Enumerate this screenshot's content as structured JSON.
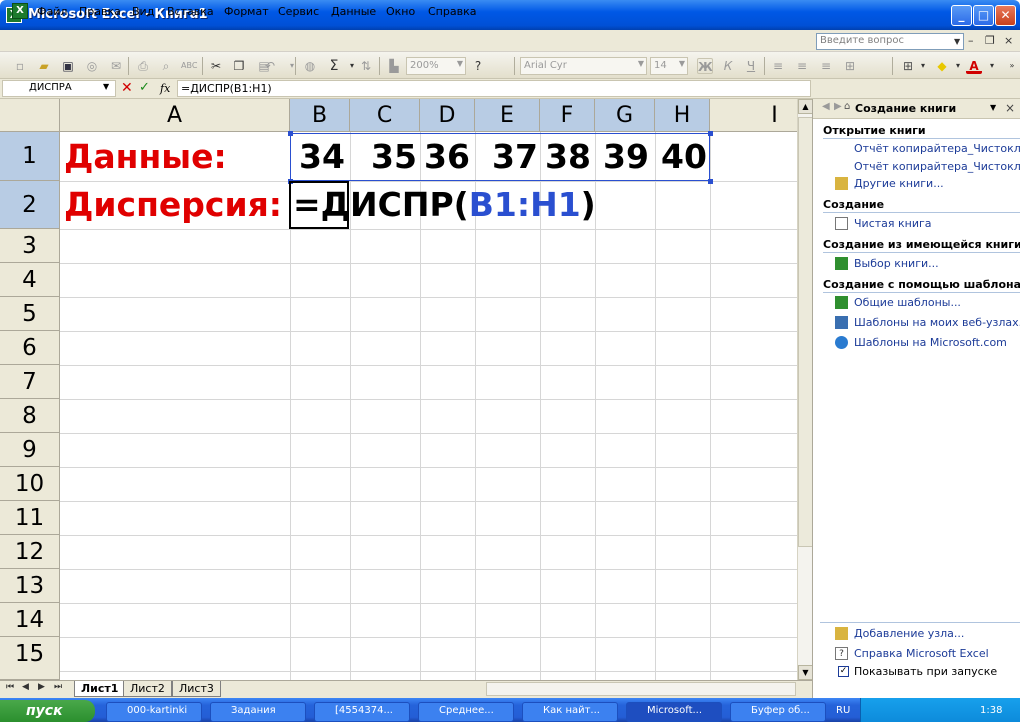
{
  "window": {
    "title": "Microsoft Excel - Книга1",
    "app_icon": "excel-icon"
  },
  "menu": {
    "items": [
      "Файл",
      "Правка",
      "Вид",
      "Вставка",
      "Формат",
      "Сервис",
      "Данные",
      "Окно",
      "Справка"
    ],
    "ask_placeholder": "Введите вопрос"
  },
  "toolbar": {
    "zoom": "200%",
    "font_name": "Arial Cyr",
    "font_size": "14",
    "bold": "Ж",
    "italic": "К",
    "underline": "Ч"
  },
  "formula_bar": {
    "name_box": "ДИСПРА",
    "fx": "fx",
    "formula": "=ДИСПР(B1:H1)"
  },
  "columns": [
    "A",
    "B",
    "C",
    "D",
    "E",
    "F",
    "G",
    "H",
    "I"
  ],
  "rows": [
    "1",
    "2",
    "3",
    "4",
    "5",
    "6",
    "7",
    "8",
    "9",
    "10",
    "11",
    "12",
    "13",
    "14",
    "15"
  ],
  "cells": {
    "a1": "Данные:",
    "a2": "Дисперсия:",
    "b1": "34",
    "c1": "35",
    "d1": "36",
    "e1": "37",
    "f1": "38",
    "g1": "39",
    "h1": "40",
    "b2_prefix": "=ДИСПР(",
    "b2_ref": "B1:H1",
    "b2_suffix": ")"
  },
  "sheets": [
    "Лист1",
    "Лист2",
    "Лист3"
  ],
  "task_pane": {
    "title": "Создание книги",
    "open_section": "Открытие книги",
    "recent_1": "Отчёт копирайтера_Чистоклето",
    "recent_2": "Отчёт копирайтера_Чистоклето",
    "more_books": "Другие книги...",
    "create_section": "Создание",
    "blank_book": "Чистая книга",
    "existing_section": "Создание из имеющейся книги",
    "choose_book": "Выбор книги...",
    "template_section": "Создание с помощью шаблона",
    "general_templates": "Общие шаблоны...",
    "web_templates": "Шаблоны на моих веб-узлах...",
    "ms_templates": "Шаблоны на Microsoft.com",
    "add_node": "Добавление узла...",
    "excel_help": "Справка Microsoft Excel",
    "show_startup": "Показывать при запуске"
  },
  "taskbar": {
    "start": "пуск",
    "tasks": [
      "000-kartinki",
      "Задания",
      "[4554374...",
      "Среднее...",
      "Как найт...",
      "Microsoft...",
      "Буфер об..."
    ],
    "lang": "RU",
    "clock": "1:38"
  },
  "colors": {
    "title_blue": "#0058e6",
    "label_red": "#e00000",
    "ref_blue": "#2a4fd0",
    "header_bg": "#ece9d8",
    "selected_header": "#b8cce4"
  }
}
